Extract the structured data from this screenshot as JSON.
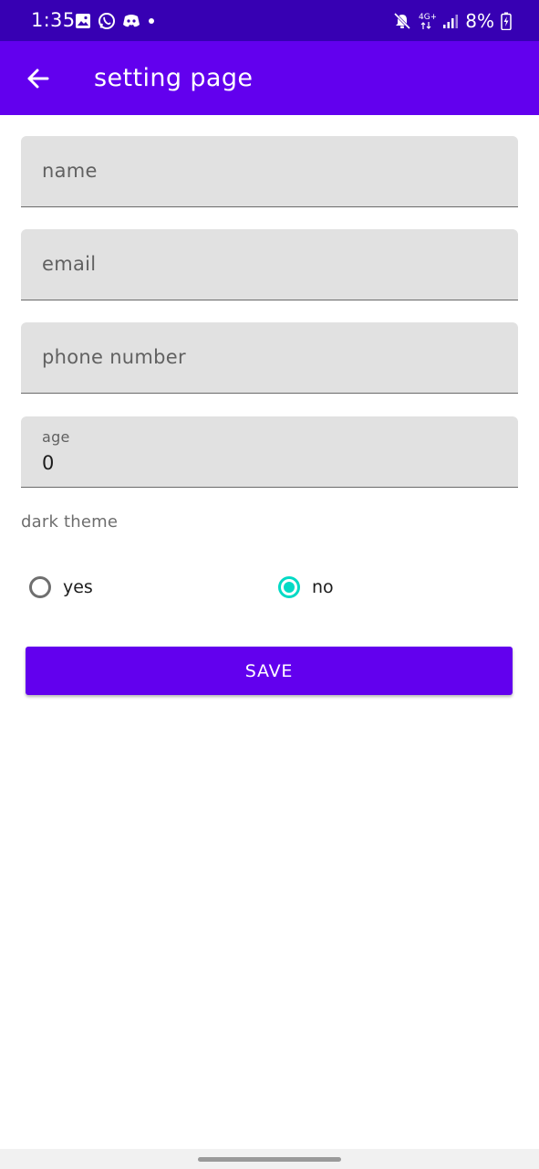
{
  "status_bar": {
    "time": "1:35",
    "left_icons": [
      "gallery-icon",
      "whatsapp-icon",
      "discord-icon",
      "dot-icon"
    ],
    "right_icons": [
      "mute-icon",
      "network-4g-icon",
      "signal-icon",
      "battery-icon"
    ],
    "network_label": "4G+",
    "battery": "8%"
  },
  "app_bar": {
    "back_icon": "arrow-left-icon",
    "title": "setting page"
  },
  "form": {
    "name": {
      "placeholder": "name",
      "value": ""
    },
    "email": {
      "placeholder": "email",
      "value": ""
    },
    "phone": {
      "placeholder": "phone number",
      "value": ""
    },
    "age": {
      "label": "age",
      "value": "0"
    }
  },
  "theme": {
    "label": "dark theme",
    "options": [
      {
        "label": "yes",
        "selected": false
      },
      {
        "label": "no",
        "selected": true
      }
    ]
  },
  "save_button": {
    "label": "SAVE"
  },
  "colors": {
    "status_bar": "#3700b3",
    "primary": "#6200ee",
    "accent": "#03dac5",
    "field_bg": "#e1e1e1"
  }
}
